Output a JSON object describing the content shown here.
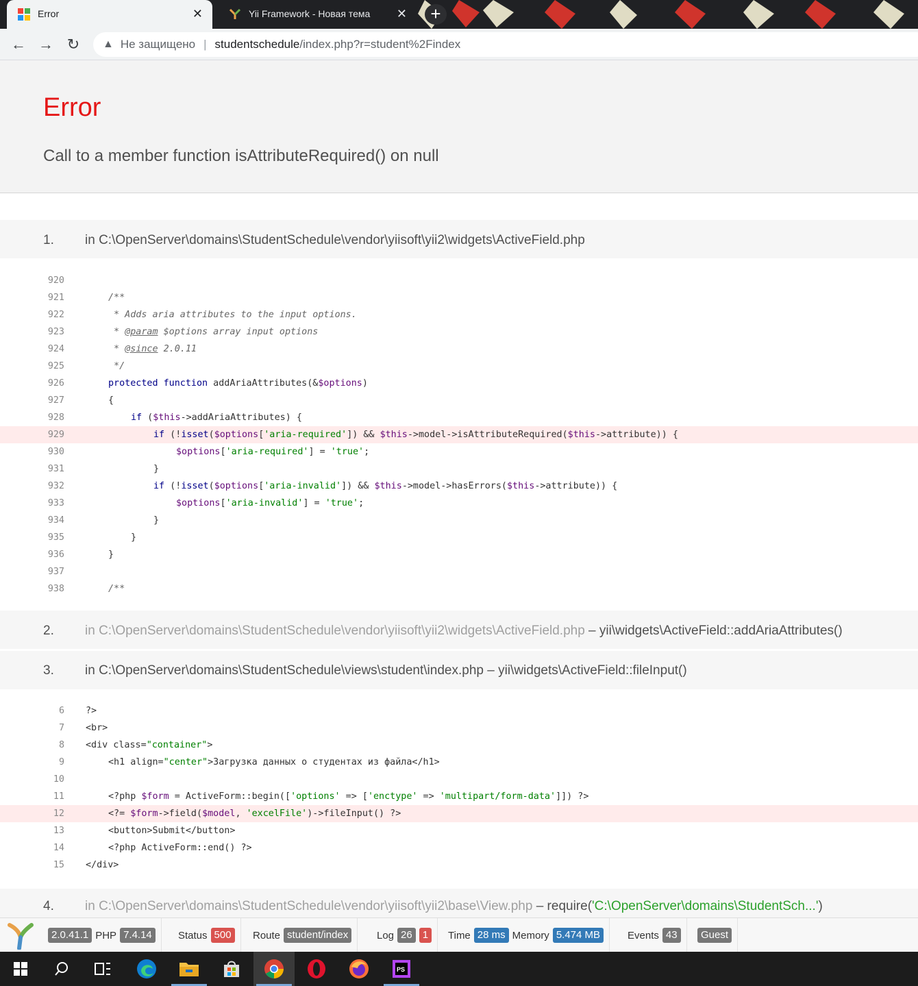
{
  "browser": {
    "tabs": [
      {
        "title": "Error",
        "active": true
      },
      {
        "title": "Yii Framework - Новая тема",
        "active": false
      }
    ],
    "omnibox": {
      "security": "Не защищено",
      "host": "studentschedule",
      "path": "/index.php?r=student%2Findex"
    }
  },
  "error": {
    "title": "Error",
    "message": "Call to a member function isAttributeRequired() on null"
  },
  "stack": [
    {
      "num": "1.",
      "file": "in C:\\OpenServer\\domains\\StudentSchedule\\vendor\\yiisoft\\yii2\\widgets\\ActiveField.php"
    },
    {
      "num": "2.",
      "file": "in C:\\OpenServer\\domains\\StudentSchedule\\vendor\\yiisoft\\yii2\\widgets\\ActiveField.php",
      "dash": " – ",
      "call": "yii\\widgets\\ActiveField::addAriaAttributes()"
    },
    {
      "num": "3.",
      "file": "in C:\\OpenServer\\domains\\StudentSchedule\\views\\student\\index.php",
      "dash": " – ",
      "call": "yii\\widgets\\ActiveField::fileInput()"
    },
    {
      "num": "4.",
      "file": "in C:\\OpenServer\\domains\\StudentSchedule\\vendor\\yiisoft\\yii2\\base\\View.php",
      "dash": " – ",
      "call": "require(",
      "arg": "'C:\\OpenServer\\domains\\StudentSch...'",
      "close": ")"
    }
  ],
  "code1": {
    "lines": [
      "920",
      "921",
      "922",
      "923",
      "924",
      "925",
      "926",
      "927",
      "928",
      "929",
      "930",
      "931",
      "932",
      "933",
      "934",
      "935",
      "936",
      "937",
      "938"
    ],
    "t": {
      "l921": "/**",
      "l922": " * Adds aria attributes to the input options.",
      "l923a": " * ",
      "l923b": "@param",
      "l923c": " $options array input options",
      "l924a": " * ",
      "l924b": "@since",
      "l924c": " 2.0.11",
      "l925": " */",
      "l926a": "protected function",
      "l926b": " addAriaAttributes(&",
      "l926c": "$options",
      "l926d": ")",
      "l927": "{",
      "l928a": "if",
      "l928b": " (",
      "l928c": "$this",
      "l928d": "->addAriaAttributes) {",
      "l929a": "if",
      "l929b": " (!",
      "l929c": "isset",
      "l929d": "(",
      "l929e": "$options",
      "l929f": "[",
      "l929g": "'aria-required'",
      "l929h": "]) && ",
      "l929i": "$this",
      "l929j": "->model->isAttributeRequired(",
      "l929k": "$this",
      "l929l": "->attribute)) {",
      "l930a": "$options",
      "l930b": "[",
      "l930c": "'aria-required'",
      "l930d": "] = ",
      "l930e": "'true'",
      "l930f": ";",
      "l931": "}",
      "l932a": "if",
      "l932b": " (!",
      "l932c": "isset",
      "l932d": "(",
      "l932e": "$options",
      "l932f": "[",
      "l932g": "'aria-invalid'",
      "l932h": "]) && ",
      "l932i": "$this",
      "l932j": "->model->hasErrors(",
      "l932k": "$this",
      "l932l": "->attribute)) {",
      "l933a": "$options",
      "l933b": "[",
      "l933c": "'aria-invalid'",
      "l933d": "] = ",
      "l933e": "'true'",
      "l933f": ";",
      "l934": "}",
      "l935": "}",
      "l936": "}",
      "l938": "/**"
    }
  },
  "code3": {
    "lines": [
      "6",
      "7",
      "8",
      "9",
      "10",
      "11",
      "12",
      "13",
      "14",
      "15"
    ],
    "t": {
      "l6": "?>",
      "l7": "<br>",
      "l8a": "<div class=",
      "l8b": "\"container\"",
      "l8c": ">",
      "l9a": "<h1 align=",
      "l9b": "\"center\"",
      "l9c": ">Загрузка данных о студентах из файла</h1>",
      "l11a": "<?php ",
      "l11b": "$form",
      "l11c": " = ActiveForm::begin([",
      "l11d": "'options'",
      "l11e": " => [",
      "l11f": "'enctype'",
      "l11g": " => ",
      "l11h": "'multipart/form-data'",
      "l11i": "]]) ?>",
      "l12a": "<?= ",
      "l12b": "$form",
      "l12c": "->field(",
      "l12d": "$model",
      "l12e": ", ",
      "l12f": "'excelFile'",
      "l12g": ")->fileInput() ?>",
      "l13": "<button>Submit</button>",
      "l14": "<?php ActiveForm::end() ?>",
      "l15": "</div>"
    }
  },
  "debug": {
    "yii_version": "2.0.41.1",
    "php_label": "PHP",
    "php_version": "7.4.14",
    "status_label": "Status",
    "status_code": "500",
    "route_label": "Route",
    "route": "student/index",
    "log_label": "Log",
    "log_count": "26",
    "log_errors": "1",
    "time_label": "Time",
    "time": "28 ms",
    "memory_label": "Memory",
    "memory": "5.474 MB",
    "events_label": "Events",
    "events": "43",
    "user": "Guest"
  }
}
